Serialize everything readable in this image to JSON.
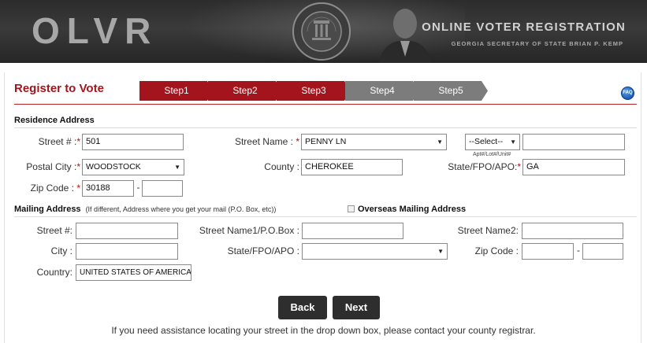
{
  "banner": {
    "logo": "OLVR",
    "title": "ONLINE VOTER REGISTRATION",
    "subtitle": "GEORGIA SECRETARY OF STATE BRIAN P. KEMP",
    "seal_text": "SECRETARY OF STATE BRIAN KEMP"
  },
  "page": {
    "title": "Register to Vote",
    "faq_icon_text": "FAQ"
  },
  "steps": [
    {
      "label": "Step1",
      "state": "done"
    },
    {
      "label": "Step2",
      "state": "done"
    },
    {
      "label": "Step3",
      "state": "done"
    },
    {
      "label": "Step4",
      "state": "todo"
    },
    {
      "label": "Step5",
      "state": "todo"
    }
  ],
  "residence": {
    "heading": "Residence Address",
    "street_number_label": "Street # :",
    "street_number": "501",
    "street_name_label": "Street Name : ",
    "street_name": "PENNY LN",
    "suffix_select": "--Select--",
    "apt_label_small": "Apt#/Lot#/Unit#",
    "apt_value": "",
    "postal_city_label": "Postal City :",
    "postal_city": "WOODSTOCK",
    "county_label": "County :",
    "county": "CHEROKEE",
    "state_label": "State/FPO/APO:",
    "state": "GA",
    "zip_label": "Zip Code : ",
    "zip": "30188",
    "zip_ext": "",
    "required_mark": "*"
  },
  "mailing": {
    "heading": "Mailing Address",
    "hint": "(If different, Address where you get your mail (P.O. Box, etc))",
    "overseas_label": "Overseas Mailing Address",
    "street_number_label": "Street #:",
    "street_number": "",
    "street_name1_label": "Street Name1/P.O.Box :",
    "street_name1": "",
    "street_name2_label": "Street Name2:",
    "street_name2": "",
    "city_label": "City :",
    "city": "",
    "state_label": "State/FPO/APO :",
    "state": "",
    "zip_label": "Zip Code :",
    "zip": "",
    "zip_ext": "",
    "country_label": "Country:",
    "country": "UNITED STATES OF AMERICA"
  },
  "buttons": {
    "back": "Back",
    "next": "Next"
  },
  "footer": "If you need assistance locating your street in the drop down box, please contact your county registrar.",
  "colors": {
    "brand_red": "#a3141d",
    "step_grey": "#7c7c7c",
    "button_dark": "#2e2e2e"
  }
}
